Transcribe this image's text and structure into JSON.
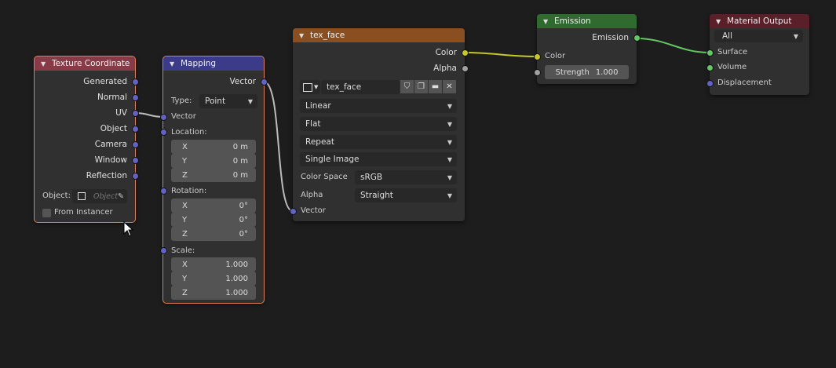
{
  "nodes": {
    "texcoord": {
      "title": "Texture Coordinate",
      "outputs": [
        "Generated",
        "Normal",
        "UV",
        "Object",
        "Camera",
        "Window",
        "Reflection"
      ],
      "object_label": "Object:",
      "object_placeholder": "Object",
      "from_instancer": "From Instancer",
      "header_color": "#893a47"
    },
    "mapping": {
      "title": "Mapping",
      "output": "Vector",
      "type_label": "Type:",
      "type_value": "Point",
      "vector_label": "Vector",
      "location_label": "Location:",
      "location": [
        {
          "axis": "X",
          "value": "0 m"
        },
        {
          "axis": "Y",
          "value": "0 m"
        },
        {
          "axis": "Z",
          "value": "0 m"
        }
      ],
      "rotation_label": "Rotation:",
      "rotation": [
        {
          "axis": "X",
          "value": "0°"
        },
        {
          "axis": "Y",
          "value": "0°"
        },
        {
          "axis": "Z",
          "value": "0°"
        }
      ],
      "scale_label": "Scale:",
      "scale": [
        {
          "axis": "X",
          "value": "1.000"
        },
        {
          "axis": "Y",
          "value": "1.000"
        },
        {
          "axis": "Z",
          "value": "1.000"
        }
      ],
      "header_color": "#3b3b8a"
    },
    "tex": {
      "title": "tex_face",
      "output_color": "Color",
      "output_alpha": "Alpha",
      "image_name": "tex_face",
      "interpolation": "Linear",
      "projection": "Flat",
      "extension": "Repeat",
      "source": "Single Image",
      "color_space_label": "Color Space",
      "color_space": "sRGB",
      "alpha_label": "Alpha",
      "alpha_mode": "Straight",
      "input_vector": "Vector",
      "header_color": "#8a4f21"
    },
    "emission": {
      "title": "Emission",
      "output": "Emission",
      "input_color": "Color",
      "strength_label": "Strength",
      "strength_value": "1.000",
      "header_color": "#2f6b2f"
    },
    "output": {
      "title": "Material Output",
      "target": "All",
      "inputs": [
        "Surface",
        "Volume",
        "Displacement"
      ],
      "header_color": "#5a1f28"
    }
  }
}
